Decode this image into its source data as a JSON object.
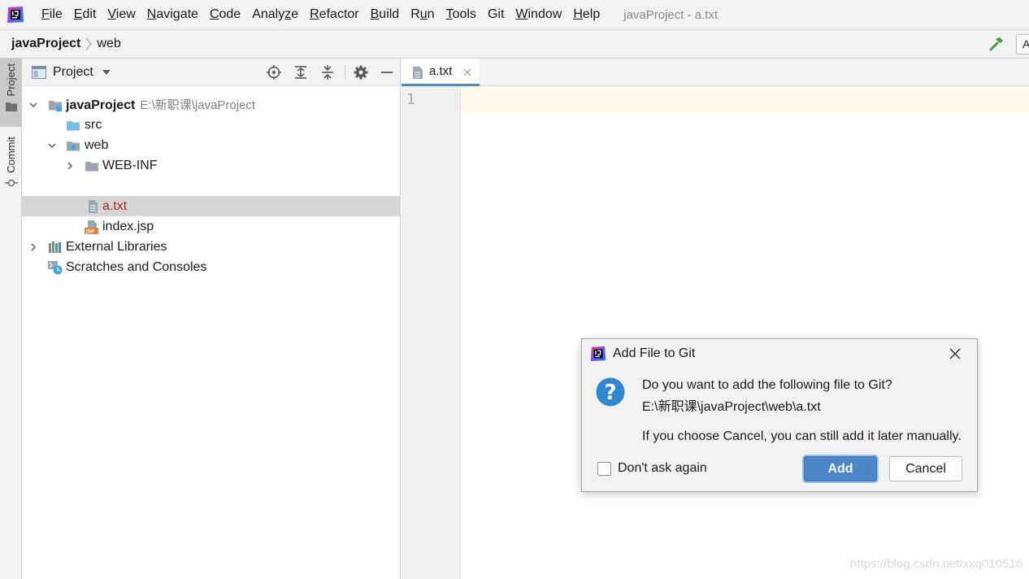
{
  "window_title": "javaProject - a.txt",
  "menu": [
    {
      "label": "File",
      "mnemonic_index": 0
    },
    {
      "label": "Edit",
      "mnemonic_index": 0
    },
    {
      "label": "View",
      "mnemonic_index": 0
    },
    {
      "label": "Navigate",
      "mnemonic_index": 0
    },
    {
      "label": "Code",
      "mnemonic_index": 0
    },
    {
      "label": "Analyze",
      "mnemonic_index": 5
    },
    {
      "label": "Refactor",
      "mnemonic_index": 0
    },
    {
      "label": "Build",
      "mnemonic_index": 0
    },
    {
      "label": "Run",
      "mnemonic_index": 1
    },
    {
      "label": "Tools",
      "mnemonic_index": 0
    },
    {
      "label": "Git",
      "mnemonic_index": -1
    },
    {
      "label": "Window",
      "mnemonic_index": 0
    },
    {
      "label": "Help",
      "mnemonic_index": 0
    }
  ],
  "breadcrumb": {
    "project": "javaProject",
    "folder": "web"
  },
  "navbar_right_text": "A",
  "tool_strip": {
    "project": "Project",
    "commit": "Commit"
  },
  "project_panel": {
    "title": "Project",
    "tree": [
      {
        "label": "javaProject",
        "path": "E:\\新职课\\javaProject",
        "icon": "module-folder-icon",
        "level": 0,
        "expanded": true,
        "bold": true
      },
      {
        "label": "src",
        "icon": "source-folder-icon",
        "level": 1
      },
      {
        "label": "web",
        "icon": "web-folder-icon",
        "level": 1,
        "expanded": true
      },
      {
        "label": "WEB-INF",
        "icon": "folder-icon",
        "level": 2,
        "expanded": false
      },
      {
        "label": "a.txt",
        "icon": "text-file-icon",
        "level": 2,
        "selected": true,
        "color": "#b3261e"
      },
      {
        "label": "index.jsp",
        "icon": "jsp-file-icon",
        "level": 2
      },
      {
        "label": "External Libraries",
        "icon": "libraries-icon",
        "level": 0,
        "expanded": false
      },
      {
        "label": "Scratches and Consoles",
        "icon": "scratches-icon",
        "level": 0
      }
    ]
  },
  "editor": {
    "tab_label": "a.txt",
    "line_number": "1"
  },
  "dialog": {
    "title": "Add File to Git",
    "question": "Do you want to add the following file to Git?",
    "file_path": "E:\\新职课\\javaProject\\web\\a.txt",
    "hint": "If you choose Cancel, you can still add it later manually.",
    "checkbox_label": "Don't ask again",
    "add_label": "Add",
    "cancel_label": "Cancel"
  },
  "watermark": "https://blog.csdn.net/xxq010516",
  "colors": {
    "accent": "#4a86c8",
    "selected_row": "#d5d5d5",
    "modified_file": "#b3261e"
  }
}
